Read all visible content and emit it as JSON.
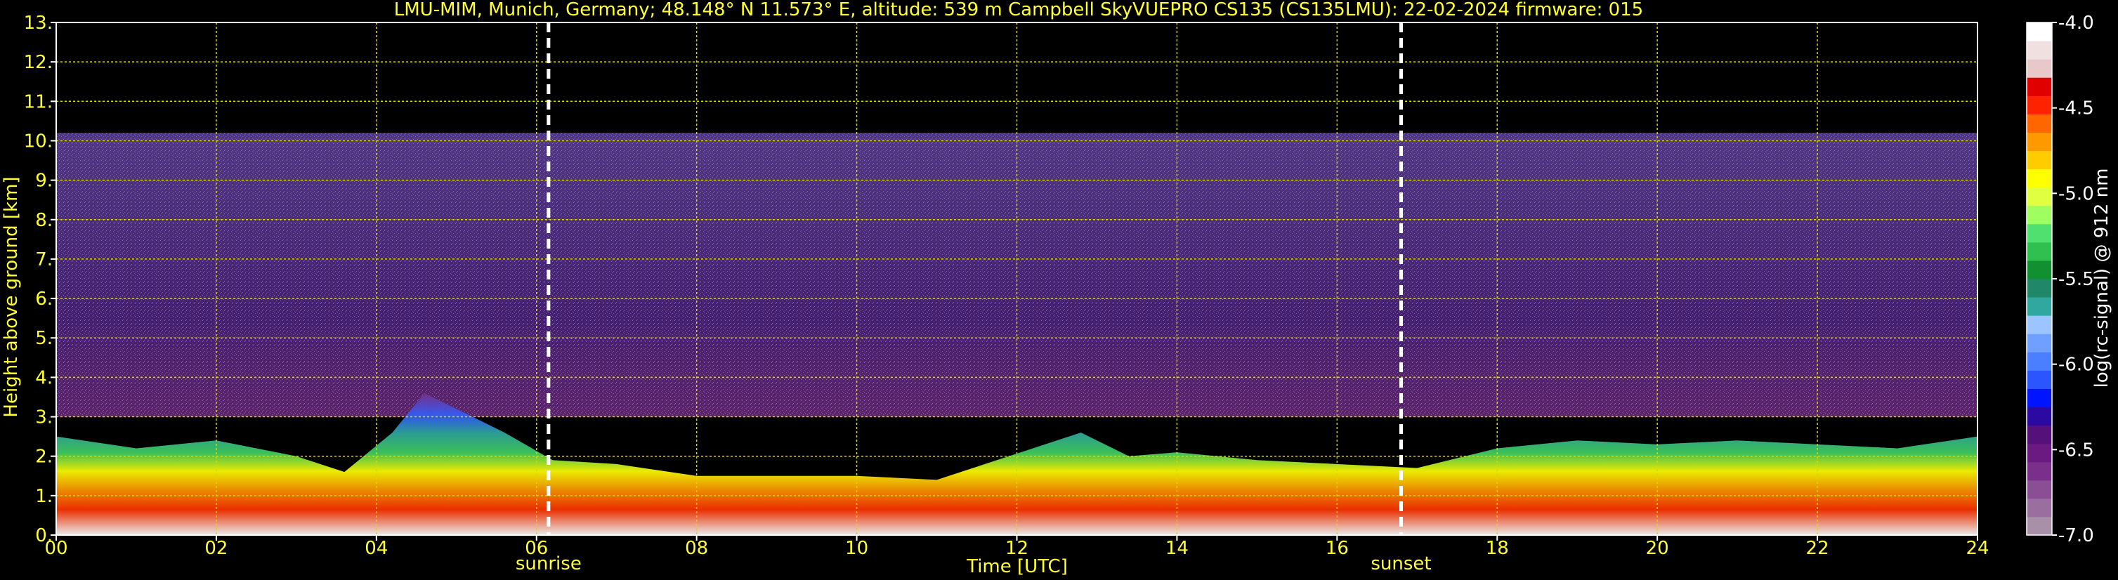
{
  "chart_data": {
    "type": "heatmap",
    "title": "LMU-MIM, Munich, Germany; 48.148° N 11.573° E, altitude: 539 m    Campbell SkyVUEPRO CS135 (CS135LMU): 22-02-2024    firmware: 015",
    "xlabel": "Time [UTC]",
    "ylabel": "Height above ground [km]",
    "xlim": [
      0,
      24
    ],
    "ylim": [
      0,
      13
    ],
    "x_ticks": [
      {
        "v": 0,
        "label": "00"
      },
      {
        "v": 2,
        "label": "02"
      },
      {
        "v": 4,
        "label": "04"
      },
      {
        "v": 6,
        "label": "06"
      },
      {
        "v": 8,
        "label": "08"
      },
      {
        "v": 10,
        "label": "10"
      },
      {
        "v": 12,
        "label": "12"
      },
      {
        "v": 14,
        "label": "14"
      },
      {
        "v": 16,
        "label": "16"
      },
      {
        "v": 18,
        "label": "18"
      },
      {
        "v": 20,
        "label": "20"
      },
      {
        "v": 22,
        "label": "22"
      },
      {
        "v": 24,
        "label": "24"
      }
    ],
    "y_ticks": [
      {
        "v": 0,
        "label": "0."
      },
      {
        "v": 1,
        "label": "1."
      },
      {
        "v": 2,
        "label": "2."
      },
      {
        "v": 3,
        "label": "3."
      },
      {
        "v": 4,
        "label": "4."
      },
      {
        "v": 5,
        "label": "5."
      },
      {
        "v": 6,
        "label": "6."
      },
      {
        "v": 7,
        "label": "7."
      },
      {
        "v": 8,
        "label": "8."
      },
      {
        "v": 9,
        "label": "9."
      },
      {
        "v": 10,
        "label": "10."
      },
      {
        "v": 11,
        "label": "11."
      },
      {
        "v": 12,
        "label": "12."
      },
      {
        "v": 13,
        "label": "13."
      }
    ],
    "grid": true,
    "markers": [
      {
        "time": 6.15,
        "label": "sunrise"
      },
      {
        "time": 16.8,
        "label": "sunset"
      }
    ],
    "colorbar": {
      "label": "log(rc-signal) @ 912 nm",
      "range": [
        -7.0,
        -4.0
      ],
      "ticks": [
        {
          "v": -4.0,
          "label": "-4.0"
        },
        {
          "v": -4.5,
          "label": "-4.5"
        },
        {
          "v": -5.0,
          "label": "-5.0"
        },
        {
          "v": -5.5,
          "label": "-5.5"
        },
        {
          "v": -6.0,
          "label": "-6.0"
        },
        {
          "v": -6.5,
          "label": "-6.5"
        },
        {
          "v": -7.0,
          "label": "-7.0"
        }
      ],
      "colors": [
        "#a890a8",
        "#9a6fa0",
        "#8a4e95",
        "#7a2f8a",
        "#6a1a80",
        "#55107a",
        "#2a0aa0",
        "#0014ff",
        "#2a55ff",
        "#4a80ff",
        "#70a0ff",
        "#9cc4ff",
        "#30a8a0",
        "#208868",
        "#109030",
        "#30c050",
        "#50e070",
        "#a0ff60",
        "#e0ff40",
        "#ffff00",
        "#ffcc00",
        "#ff9900",
        "#ff6600",
        "#ff2200",
        "#e00000",
        "#e8c8c8",
        "#f0e0e0",
        "#ffffff"
      ]
    },
    "layers": [
      {
        "name": "noise",
        "bottom_km": 3.0,
        "top_km": 10.2,
        "level": -6.2
      },
      {
        "name": "boundary_layer",
        "top_km_by_hour": [
          [
            0,
            2.5
          ],
          [
            1,
            2.2
          ],
          [
            2,
            2.4
          ],
          [
            3,
            2.0
          ],
          [
            3.6,
            1.6
          ],
          [
            4.2,
            2.6
          ],
          [
            4.6,
            3.6
          ],
          [
            5.0,
            3.2
          ],
          [
            5.6,
            2.6
          ],
          [
            6.2,
            1.9
          ],
          [
            7,
            1.8
          ],
          [
            8,
            1.5
          ],
          [
            9,
            1.5
          ],
          [
            10,
            1.5
          ],
          [
            11,
            1.4
          ],
          [
            11.6,
            1.8
          ],
          [
            12.2,
            2.2
          ],
          [
            12.8,
            2.6
          ],
          [
            13.4,
            2.0
          ],
          [
            14,
            2.1
          ],
          [
            15,
            1.9
          ],
          [
            16,
            1.8
          ],
          [
            17,
            1.7
          ],
          [
            18,
            2.2
          ],
          [
            19,
            2.4
          ],
          [
            20,
            2.3
          ],
          [
            21,
            2.4
          ],
          [
            22,
            2.3
          ],
          [
            23,
            2.2
          ],
          [
            24,
            2.5
          ]
        ]
      }
    ]
  }
}
